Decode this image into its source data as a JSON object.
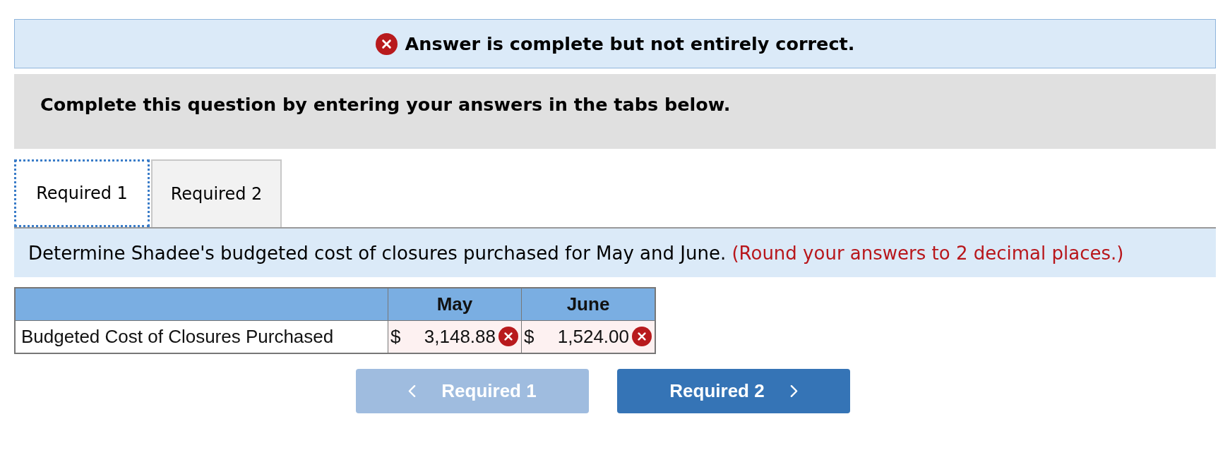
{
  "feedback": {
    "correct": false,
    "message": "Answer is complete but not entirely correct."
  },
  "instruction": "Complete this question by entering your answers in the tabs below.",
  "tabs": [
    {
      "label": "Required 1",
      "selected": true
    },
    {
      "label": "Required 2",
      "selected": false
    }
  ],
  "question": {
    "text": "Determine Shadee's budgeted cost of closures purchased for May and June.",
    "note": "(Round your answers to 2 decimal places.)"
  },
  "table": {
    "columns": [
      "May",
      "June"
    ],
    "rows": [
      {
        "label": "Budgeted Cost of Closures Purchased",
        "cells": [
          {
            "prefix": "$",
            "value": "3,148.88",
            "correct": false
          },
          {
            "prefix": "$",
            "value": "1,524.00",
            "correct": false
          }
        ]
      }
    ]
  },
  "nav": [
    {
      "label": "Required 1",
      "kind": "previous",
      "disabled": true
    },
    {
      "label": "Required 2",
      "kind": "next",
      "disabled": false
    }
  ]
}
